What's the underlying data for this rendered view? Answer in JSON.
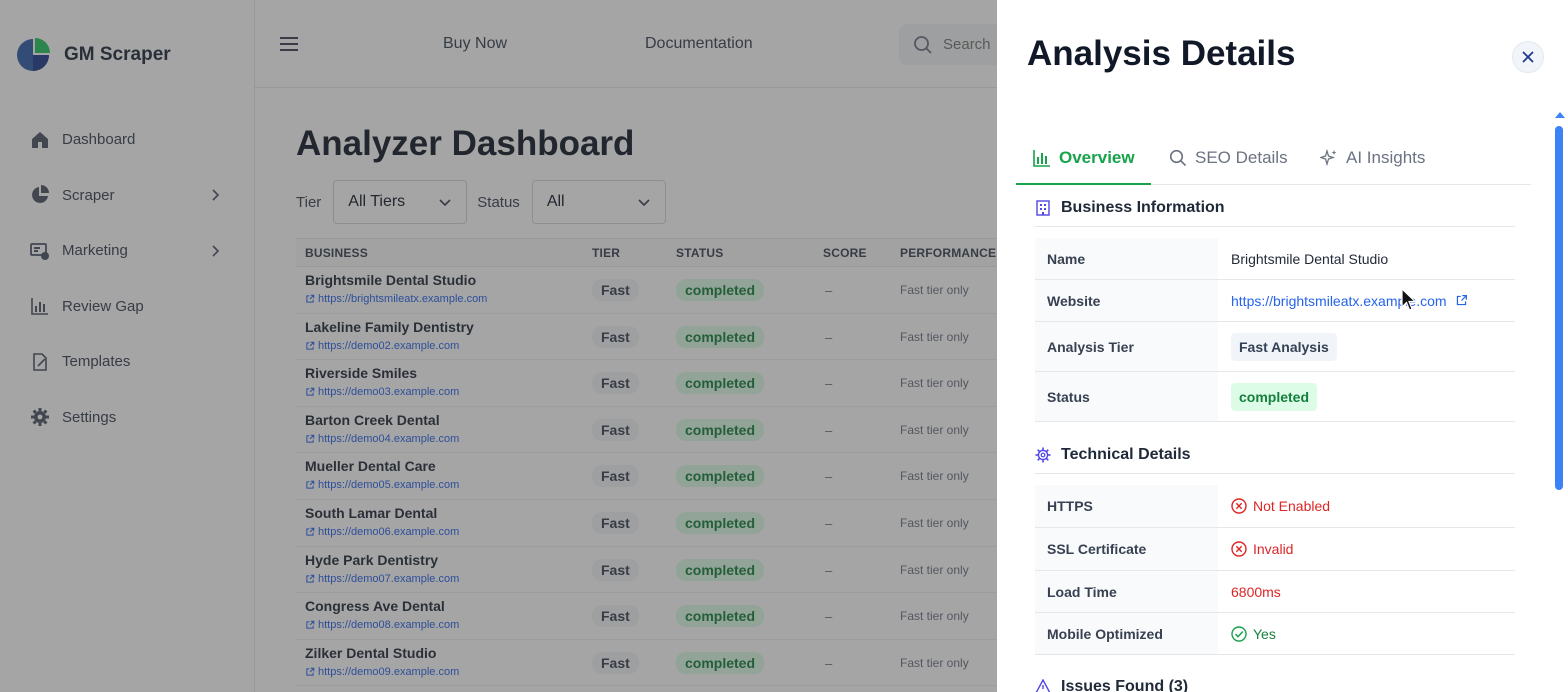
{
  "brand": {
    "name": "GM Scraper",
    "colors": {
      "primary": "#2f5ea8",
      "accent": "#16a34a"
    }
  },
  "sidebar": {
    "items": [
      {
        "label": "Dashboard",
        "icon": "home-icon",
        "has_submenu": false
      },
      {
        "label": "Scraper",
        "icon": "pie-chart-icon",
        "has_submenu": true
      },
      {
        "label": "Marketing",
        "icon": "marketing-icon",
        "has_submenu": true
      },
      {
        "label": "Review Gap",
        "icon": "bar-chart-icon",
        "has_submenu": false
      },
      {
        "label": "Templates",
        "icon": "document-icon",
        "has_submenu": false
      },
      {
        "label": "Settings",
        "icon": "gear-icon",
        "has_submenu": false
      }
    ]
  },
  "topbar": {
    "buy_label": "Buy Now",
    "doc_label": "Documentation",
    "search_placeholder": "Search"
  },
  "main": {
    "title": "Analyzer Dashboard",
    "filters": {
      "tier_label": "Tier",
      "tier_value": "All Tiers",
      "status_label": "Status",
      "status_value": "All"
    },
    "columns": [
      "BUSINESS",
      "TIER",
      "STATUS",
      "SCORE",
      "PERFORMANCE I"
    ],
    "rows": [
      {
        "name": "Brightsmile Dental Studio",
        "url": "https://brightsmileatx.example.com",
        "tier": "Fast",
        "status": "completed",
        "score": "–",
        "performance": "Fast tier only"
      },
      {
        "name": "Lakeline Family Dentistry",
        "url": "https://demo02.example.com",
        "tier": "Fast",
        "status": "completed",
        "score": "–",
        "performance": "Fast tier only"
      },
      {
        "name": "Riverside Smiles",
        "url": "https://demo03.example.com",
        "tier": "Fast",
        "status": "completed",
        "score": "–",
        "performance": "Fast tier only"
      },
      {
        "name": "Barton Creek Dental",
        "url": "https://demo04.example.com",
        "tier": "Fast",
        "status": "completed",
        "score": "–",
        "performance": "Fast tier only"
      },
      {
        "name": "Mueller Dental Care",
        "url": "https://demo05.example.com",
        "tier": "Fast",
        "status": "completed",
        "score": "–",
        "performance": "Fast tier only"
      },
      {
        "name": "South Lamar Dental",
        "url": "https://demo06.example.com",
        "tier": "Fast",
        "status": "completed",
        "score": "–",
        "performance": "Fast tier only"
      },
      {
        "name": "Hyde Park Dentistry",
        "url": "https://demo07.example.com",
        "tier": "Fast",
        "status": "completed",
        "score": "–",
        "performance": "Fast tier only"
      },
      {
        "name": "Congress Ave Dental",
        "url": "https://demo08.example.com",
        "tier": "Fast",
        "status": "completed",
        "score": "–",
        "performance": "Fast tier only"
      },
      {
        "name": "Zilker Dental Studio",
        "url": "https://demo09.example.com",
        "tier": "Fast",
        "status": "completed",
        "score": "–",
        "performance": "Fast tier only"
      }
    ]
  },
  "drawer": {
    "title": "Analysis Details",
    "tabs": [
      {
        "label": "Overview",
        "icon": "bar-chart-icon",
        "active": true
      },
      {
        "label": "SEO Details",
        "icon": "search-icon",
        "active": false
      },
      {
        "label": "AI Insights",
        "icon": "sparkles-icon",
        "active": false
      }
    ],
    "business_info": {
      "heading": "Business Information",
      "rows": [
        {
          "key": "Name",
          "value": "Brightsmile Dental Studio"
        },
        {
          "key": "Website",
          "value": "https://brightsmileatx.example.com"
        },
        {
          "key": "Analysis Tier",
          "value": "Fast Analysis"
        },
        {
          "key": "Status",
          "value": "completed"
        }
      ]
    },
    "technical": {
      "heading": "Technical Details",
      "rows": [
        {
          "key": "HTTPS",
          "value": "Not Enabled",
          "state": "bad"
        },
        {
          "key": "SSL Certificate",
          "value": "Invalid",
          "state": "bad"
        },
        {
          "key": "Load Time",
          "value": "6800ms",
          "state": "bad"
        },
        {
          "key": "Mobile Optimized",
          "value": "Yes",
          "state": "good"
        }
      ]
    },
    "issues": {
      "heading": "Issues Found (3)"
    }
  }
}
